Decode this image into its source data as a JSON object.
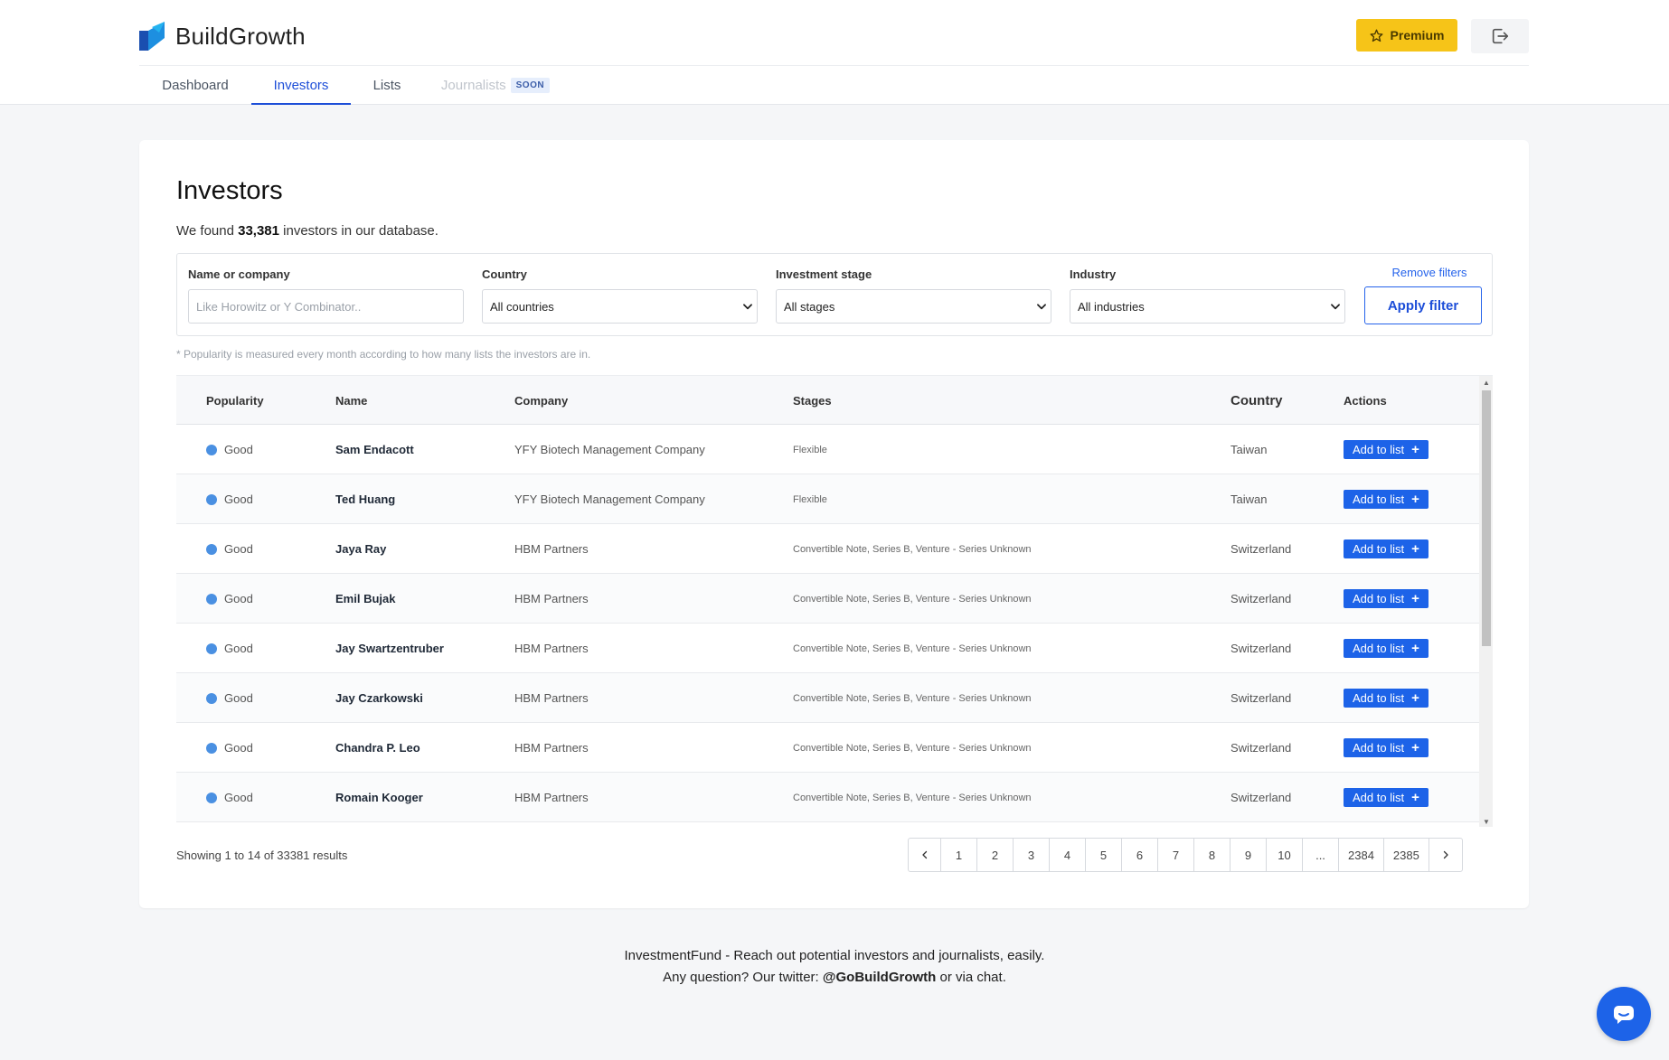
{
  "app": {
    "name": "BuildGrowth",
    "premium_label": "Premium"
  },
  "nav": {
    "tabs": [
      {
        "label": "Dashboard"
      },
      {
        "label": "Investors"
      },
      {
        "label": "Lists"
      },
      {
        "label": "Journalists",
        "badge": "SOON"
      }
    ]
  },
  "page": {
    "title": "Investors",
    "found_prefix": "We found ",
    "found_count": "33,381",
    "found_suffix": " investors in our database.",
    "note": "* Popularity is measured every month according to how many lists the investors are in."
  },
  "filters": {
    "name_label": "Name or company",
    "name_placeholder": "Like Horowitz or Y Combinator..",
    "country_label": "Country",
    "country_value": "All countries",
    "stage_label": "Investment stage",
    "stage_value": "All stages",
    "industry_label": "Industry",
    "industry_value": "All industries",
    "remove_label": "Remove filters",
    "apply_label": "Apply filter"
  },
  "table": {
    "headers": {
      "popularity": "Popularity",
      "name": "Name",
      "company": "Company",
      "stages": "Stages",
      "country": "Country",
      "actions": "Actions"
    },
    "add_label": "Add to list",
    "rows": [
      {
        "popularity": "Good",
        "name": "Sam Endacott",
        "company": "YFY Biotech Management Company",
        "stages": "Flexible",
        "country": "Taiwan"
      },
      {
        "popularity": "Good",
        "name": "Ted Huang",
        "company": "YFY Biotech Management Company",
        "stages": "Flexible",
        "country": "Taiwan"
      },
      {
        "popularity": "Good",
        "name": "Jaya Ray",
        "company": "HBM Partners",
        "stages": "Convertible Note, Series B, Venture - Series Unknown",
        "country": "Switzerland"
      },
      {
        "popularity": "Good",
        "name": "Emil Bujak",
        "company": "HBM Partners",
        "stages": "Convertible Note, Series B, Venture - Series Unknown",
        "country": "Switzerland"
      },
      {
        "popularity": "Good",
        "name": "Jay Swartzentruber",
        "company": "HBM Partners",
        "stages": "Convertible Note, Series B, Venture - Series Unknown",
        "country": "Switzerland"
      },
      {
        "popularity": "Good",
        "name": "Jay Czarkowski",
        "company": "HBM Partners",
        "stages": "Convertible Note, Series B, Venture - Series Unknown",
        "country": "Switzerland"
      },
      {
        "popularity": "Good",
        "name": "Chandra P. Leo",
        "company": "HBM Partners",
        "stages": "Convertible Note, Series B, Venture - Series Unknown",
        "country": "Switzerland"
      },
      {
        "popularity": "Good",
        "name": "Romain Kooger",
        "company": "HBM Partners",
        "stages": "Convertible Note, Series B, Venture - Series Unknown",
        "country": "Switzerland"
      }
    ]
  },
  "pagination": {
    "showing": "Showing 1 to 14 of 33381 results",
    "pages": [
      "1",
      "2",
      "3",
      "4",
      "5",
      "6",
      "7",
      "8",
      "9",
      "10",
      "...",
      "2384",
      "2385"
    ]
  },
  "footer": {
    "line1": "InvestmentFund - Reach out potential investors and journalists, easily.",
    "line2_prefix": "Any question? Our twitter: ",
    "twitter": "@GoBuildGrowth",
    "line2_suffix": " or via chat."
  },
  "colors": {
    "accent": "#1d63e8",
    "premium": "#f6c418",
    "popularity_dot": "#4a90e2"
  }
}
